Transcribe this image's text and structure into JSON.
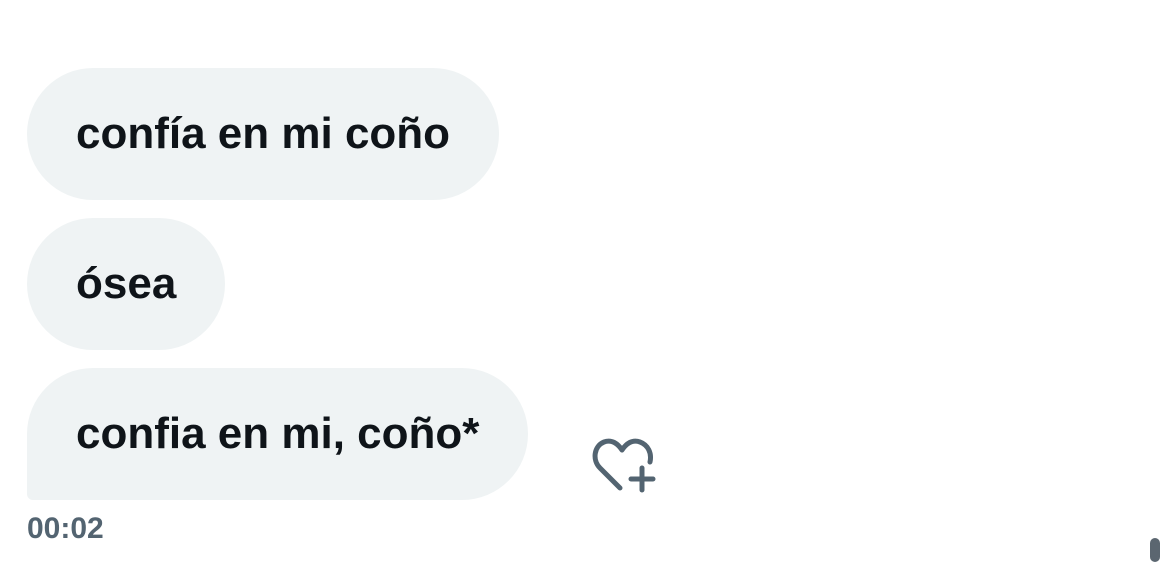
{
  "messages": [
    {
      "text": "confía en mi coño"
    },
    {
      "text": "ósea"
    },
    {
      "text": "confia en mi, coño*"
    }
  ],
  "reaction": {
    "icon": "heart-plus-icon"
  },
  "timestamp": "00:02",
  "colors": {
    "bubble_background": "#eff3f4",
    "message_text": "#0f1419",
    "timestamp_text": "#536471",
    "icon": "#536471"
  }
}
